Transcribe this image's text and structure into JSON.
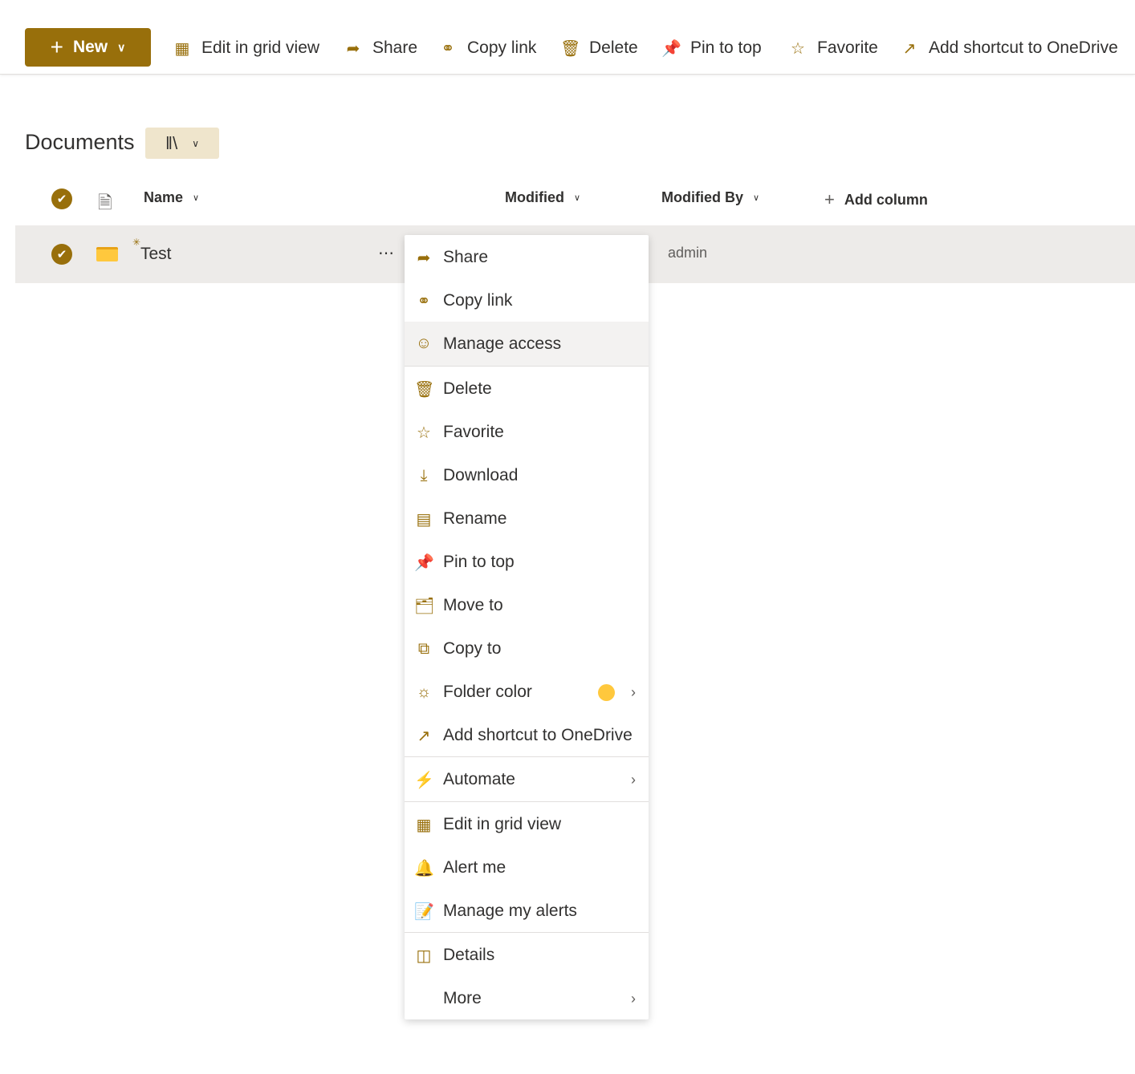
{
  "toolbar": {
    "new": "New",
    "edit_grid": "Edit in grid view",
    "share": "Share",
    "copy_link": "Copy link",
    "delete": "Delete",
    "pin": "Pin to top",
    "favorite": "Favorite",
    "shortcut": "Add shortcut to OneDrive"
  },
  "library": {
    "title": "Documents"
  },
  "columns": {
    "name": "Name",
    "modified": "Modified",
    "modified_by": "Modified By",
    "add_column": "Add column"
  },
  "rows": [
    {
      "name": "Test",
      "modified_by": "admin"
    }
  ],
  "menu": [
    {
      "label": "Share",
      "icon": "share-icon"
    },
    {
      "label": "Copy link",
      "icon": "link-icon"
    },
    {
      "label": "Manage access",
      "icon": "person-icon"
    },
    {
      "label": "Delete",
      "icon": "trash-icon"
    },
    {
      "label": "Favorite",
      "icon": "star-icon"
    },
    {
      "label": "Download",
      "icon": "download-icon"
    },
    {
      "label": "Rename",
      "icon": "rename-icon"
    },
    {
      "label": "Pin to top",
      "icon": "pin-icon"
    },
    {
      "label": "Move to",
      "icon": "move-icon"
    },
    {
      "label": "Copy to",
      "icon": "copy-icon"
    },
    {
      "label": "Folder color",
      "icon": "palette-icon"
    },
    {
      "label": "Add shortcut to OneDrive",
      "icon": "shortcut-icon"
    },
    {
      "label": "Automate",
      "icon": "automate-icon"
    },
    {
      "label": "Edit in grid view",
      "icon": "grid-icon"
    },
    {
      "label": "Alert me",
      "icon": "bell-icon"
    },
    {
      "label": "Manage my alerts",
      "icon": "alerts-icon"
    },
    {
      "label": "Details",
      "icon": "details-icon"
    },
    {
      "label": "More",
      "icon": ""
    }
  ],
  "colors": {
    "accent": "#986f0b",
    "folder_color": "#ffc83d"
  }
}
